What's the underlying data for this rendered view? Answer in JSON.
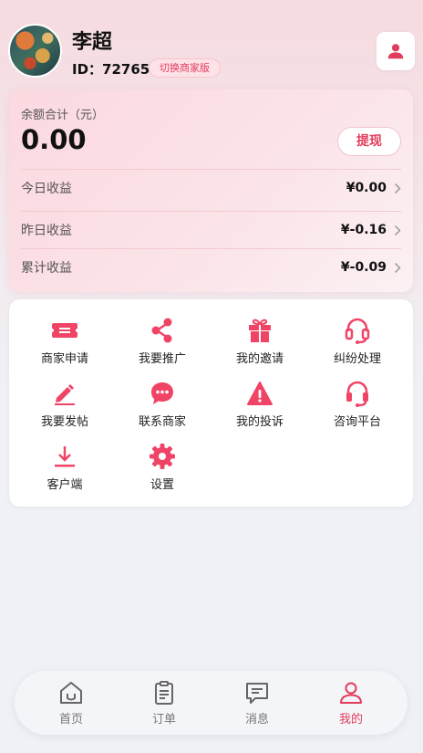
{
  "user": {
    "name": "李超",
    "id_text": "ID：72765",
    "switch_label": "切换商家版"
  },
  "balance": {
    "label": "余额合计（元）",
    "value": "0.00",
    "withdraw_label": "提现"
  },
  "stats": [
    {
      "label": "今日收益",
      "value": "¥0.00"
    },
    {
      "label": "昨日收益",
      "value": "¥-0.16"
    },
    {
      "label": "累计收益",
      "value": "¥-0.09"
    }
  ],
  "menu": [
    {
      "label": "商家申请",
      "icon": "ticket-icon"
    },
    {
      "label": "我要推广",
      "icon": "share-icon"
    },
    {
      "label": "我的邀请",
      "icon": "gift-icon"
    },
    {
      "label": "纠纷处理",
      "icon": "headset-icon"
    },
    {
      "label": "我要发帖",
      "icon": "edit-icon"
    },
    {
      "label": "联系商家",
      "icon": "chat-bubble-icon"
    },
    {
      "label": "我的投诉",
      "icon": "warning-icon"
    },
    {
      "label": "咨询平台",
      "icon": "headphones-icon"
    },
    {
      "label": "客户端",
      "icon": "download-icon"
    },
    {
      "label": "设置",
      "icon": "gear-icon"
    }
  ],
  "tabs": [
    {
      "label": "首页",
      "icon": "home-icon",
      "active": false
    },
    {
      "label": "订单",
      "icon": "clipboard-icon",
      "active": false
    },
    {
      "label": "消息",
      "icon": "message-icon",
      "active": false
    },
    {
      "label": "我的",
      "icon": "user-icon",
      "active": true
    }
  ],
  "colors": {
    "accent": "#e23c5c",
    "icon_pink": "#f04466",
    "tab_inactive": "#777777"
  }
}
